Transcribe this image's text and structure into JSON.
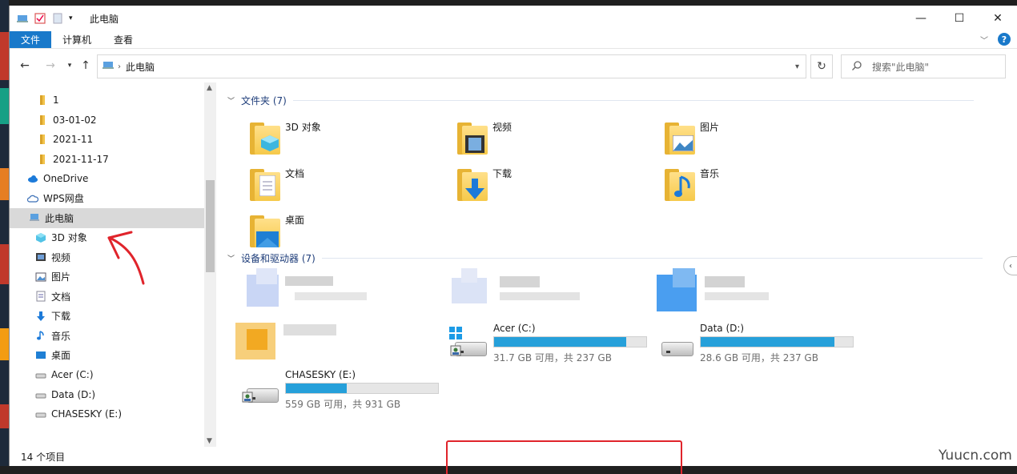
{
  "window": {
    "title": "此电脑"
  },
  "ribbon": {
    "tabs": [
      "文件",
      "计算机",
      "查看"
    ]
  },
  "address": {
    "crumb": "此电脑",
    "search_placeholder": "搜索\"此电脑\""
  },
  "nav": {
    "items": [
      {
        "label": "1",
        "icon": "folder-icon"
      },
      {
        "label": "03-01-02",
        "icon": "folder-icon"
      },
      {
        "label": "2021-11",
        "icon": "folder-icon"
      },
      {
        "label": "2021-11-17",
        "icon": "folder-icon"
      },
      {
        "label": "OneDrive",
        "icon": "onedrive-icon"
      },
      {
        "label": "WPS网盘",
        "icon": "cloud-icon"
      },
      {
        "label": "此电脑",
        "icon": "computer-icon",
        "selected": true
      },
      {
        "label": "3D 对象",
        "icon": "3d-objects-icon"
      },
      {
        "label": "视频",
        "icon": "video-icon"
      },
      {
        "label": "图片",
        "icon": "pictures-icon"
      },
      {
        "label": "文档",
        "icon": "documents-icon"
      },
      {
        "label": "下载",
        "icon": "download-icon"
      },
      {
        "label": "音乐",
        "icon": "music-icon"
      },
      {
        "label": "桌面",
        "icon": "desktop-icon"
      },
      {
        "label": "Acer (C:)",
        "icon": "drive-icon"
      },
      {
        "label": "Data (D:)",
        "icon": "drive-icon"
      },
      {
        "label": "CHASESKY (E:)",
        "icon": "drive-icon"
      }
    ]
  },
  "status": {
    "count": "14 个项目"
  },
  "folders": {
    "header": "文件夹 (7)",
    "items": [
      "3D 对象",
      "视频",
      "图片",
      "文档",
      "下载",
      "音乐",
      "桌面"
    ]
  },
  "devices": {
    "header": "设备和驱动器 (7)",
    "drives": [
      {
        "name": "Acer (C:)",
        "free": "31.7 GB 可用，共 237 GB",
        "used_fraction": 0.866
      },
      {
        "name": "Data (D:)",
        "free": "28.6 GB 可用，共 237 GB",
        "used_fraction": 0.879
      },
      {
        "name": "CHASESKY (E:)",
        "free": "559 GB 可用，共 931 GB",
        "used_fraction": 0.4
      }
    ]
  },
  "watermark": "Yuucn.com",
  "colors": {
    "accent": "#1979ca",
    "bar": "#26a0da",
    "highlight": "#e0242b"
  }
}
